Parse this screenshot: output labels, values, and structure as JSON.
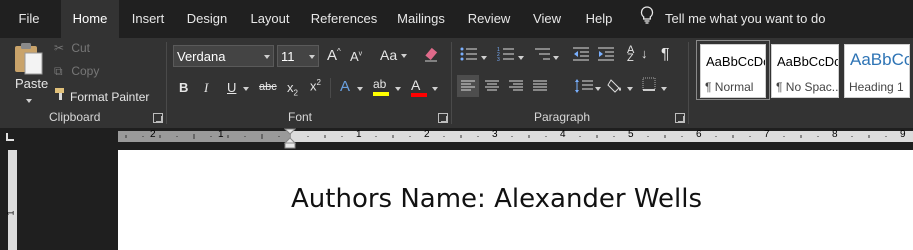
{
  "tabs": [
    {
      "label": "File"
    },
    {
      "label": "Home"
    },
    {
      "label": "Insert"
    },
    {
      "label": "Design"
    },
    {
      "label": "Layout"
    },
    {
      "label": "References"
    },
    {
      "label": "Mailings"
    },
    {
      "label": "Review"
    },
    {
      "label": "View"
    },
    {
      "label": "Help"
    }
  ],
  "active_tab": "Home",
  "tell_me": "Tell me what you want to do",
  "clipboard": {
    "paste": "Paste",
    "cut": "Cut",
    "copy": "Copy",
    "format_painter": "Format Painter",
    "group_label": "Clipboard"
  },
  "font": {
    "name": "Verdana",
    "size": "11",
    "change_case": "Aa",
    "group_label": "Font"
  },
  "paragraph": {
    "group_label": "Paragraph"
  },
  "styles": [
    {
      "sample": "AaBbCcDc",
      "name": "¶ Normal"
    },
    {
      "sample": "AaBbCcDc",
      "name": "¶ No Spac..."
    },
    {
      "sample": "AaBbCc",
      "name": "Heading 1"
    }
  ],
  "ruler": {
    "labels": [
      "2",
      "1",
      "1",
      "2",
      "3",
      "4",
      "5",
      "6",
      "7",
      "8",
      "9"
    ]
  },
  "vertical_ruler": {
    "label": "1"
  },
  "document": {
    "text": "Authors Name: Alexander Wells"
  },
  "colors": {
    "highlight": "#ffff00",
    "font_color": "#ff0000",
    "heading_blue": "#2e74b5"
  }
}
